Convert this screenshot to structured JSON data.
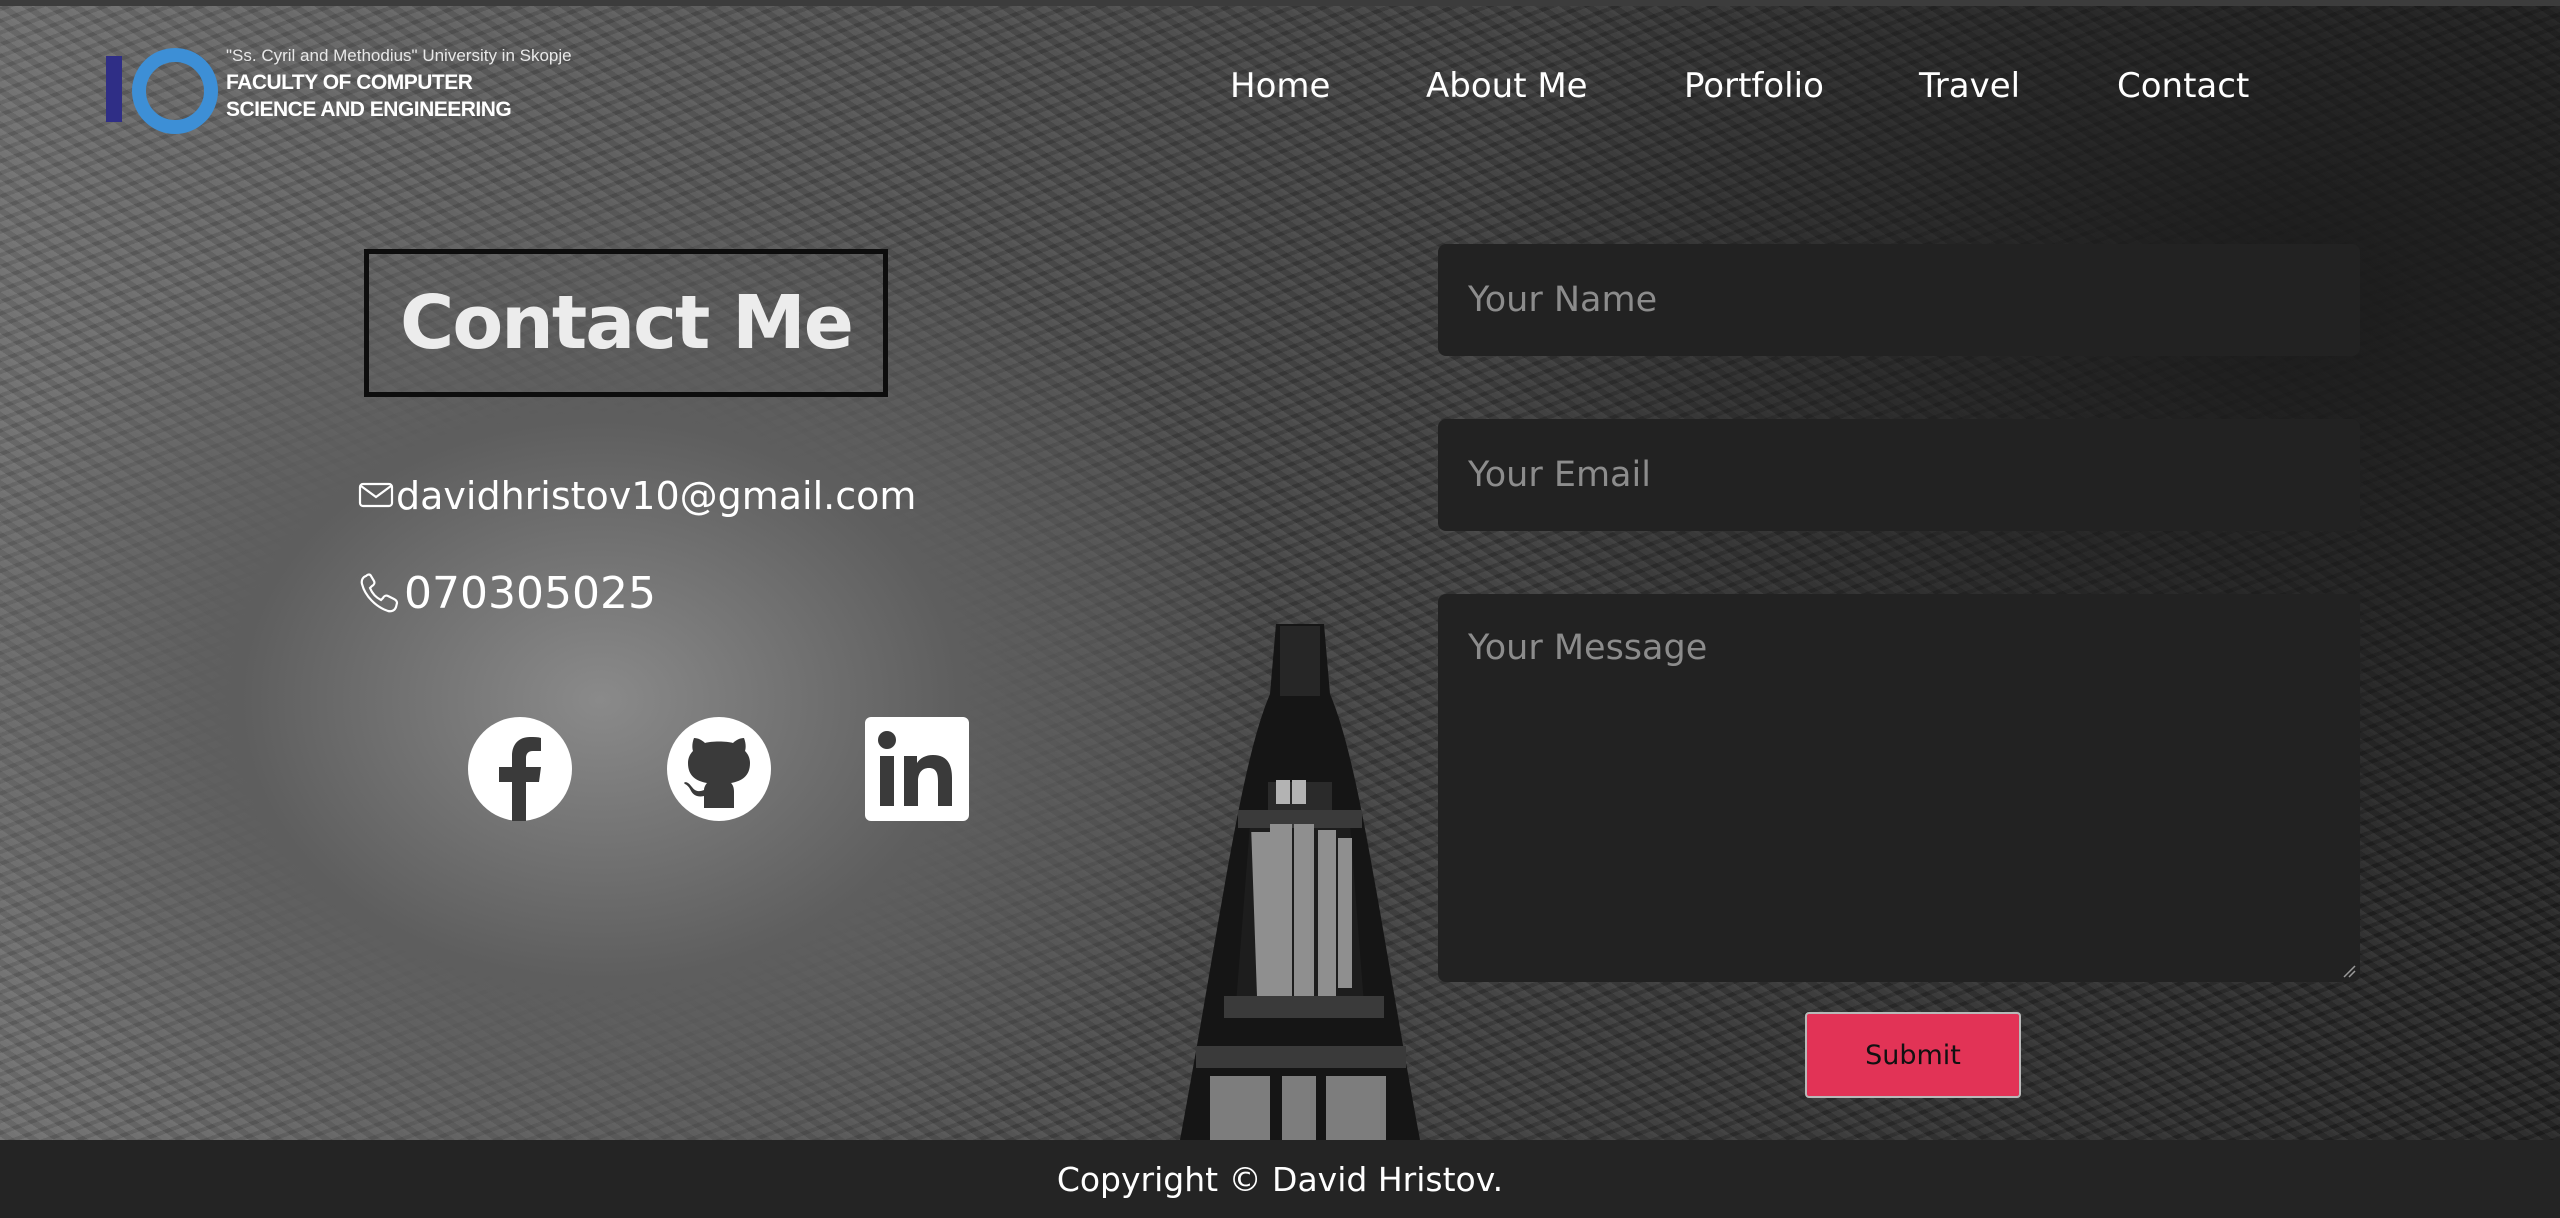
{
  "logo": {
    "university": "\"Ss. Cyril and Methodius\" University in Skopje",
    "line1": "FACULTY OF COMPUTER",
    "line2": "SCIENCE AND ENGINEERING"
  },
  "nav": {
    "items": [
      {
        "label": "Home"
      },
      {
        "label": "About Me"
      },
      {
        "label": "Portfolio"
      },
      {
        "label": "Travel"
      },
      {
        "label": "Contact"
      }
    ]
  },
  "contact": {
    "title": "Contact Me",
    "email": "davidhristov10@gmail.com",
    "phone": "070305025",
    "email_icon": "envelope-icon",
    "phone_icon": "phone-icon"
  },
  "social": [
    {
      "icon": "facebook-icon"
    },
    {
      "icon": "github-icon"
    },
    {
      "icon": "linkedin-icon"
    }
  ],
  "form": {
    "name_placeholder": "Your Name",
    "email_placeholder": "Your Email",
    "message_placeholder": "Your Message",
    "submit_label": "Submit"
  },
  "footer": {
    "copyright": "Copyright © David Hristov."
  },
  "colors": {
    "submit": "#e23356",
    "field_bg": "#222222",
    "footer_bg": "#242424",
    "logo_blue": "#3d8fd6",
    "logo_navy": "#2f2e86"
  }
}
